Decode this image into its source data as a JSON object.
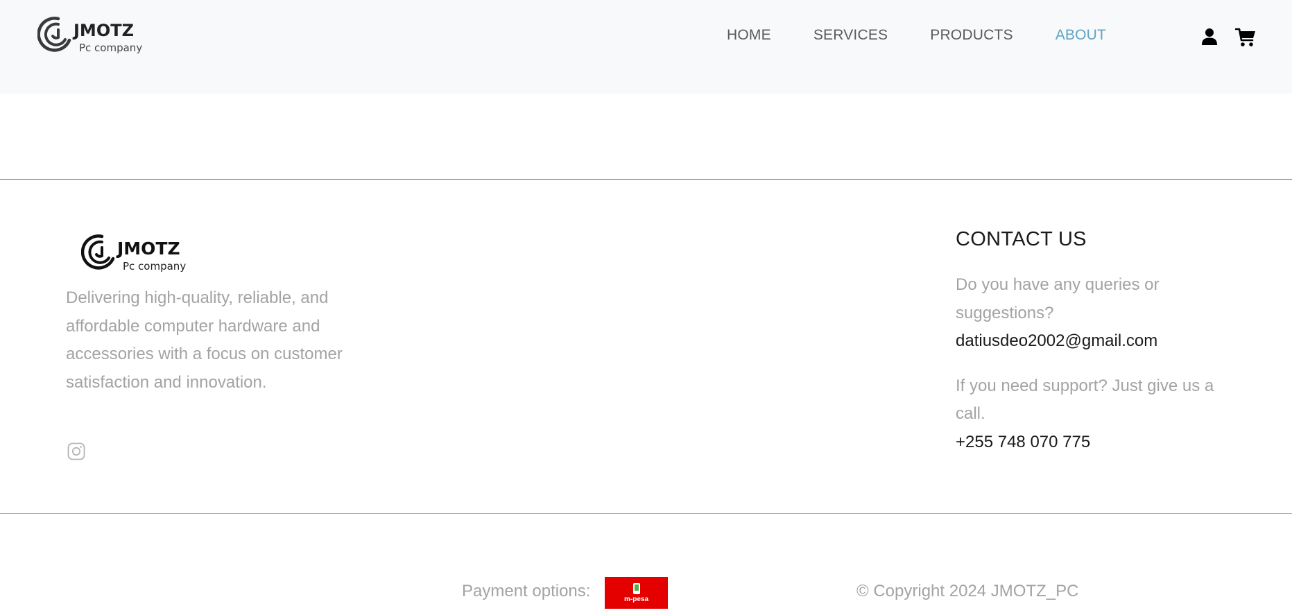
{
  "header": {
    "logo": {
      "brand": "JMOTZ",
      "tagline": "Pc company"
    },
    "nav": [
      {
        "label": "HOME",
        "active": false
      },
      {
        "label": "SERVICES",
        "active": false
      },
      {
        "label": "PRODUCTS",
        "active": false
      },
      {
        "label": "ABOUT",
        "active": true
      }
    ],
    "icons": {
      "user": "user-icon",
      "cart": "cart-icon"
    }
  },
  "footer": {
    "logo": {
      "brand": "JMOTZ",
      "tagline": "Pc company"
    },
    "about": "Delivering high-quality, reliable, and affordable computer hardware and accessories with a focus on customer satisfaction and innovation.",
    "social": [
      "instagram-icon"
    ],
    "contact": {
      "title": "CONTACT US",
      "queries_text": "Do you have any queries or suggestions?",
      "email": "datiusdeo2002@gmail.com",
      "support_text": "If you need support? Just give us a call.",
      "phone": "+255 748 070 775"
    },
    "payment": {
      "label": "Payment options:",
      "method": "m-pesa"
    },
    "copyright": "© Copyright 2024 JMOTZ_PC"
  },
  "colors": {
    "header_bg": "#f8f9fa",
    "nav_text": "#5a5a5a",
    "nav_active": "#5fa3c4",
    "muted_text": "#a3a3a3",
    "dark_text": "#1a1a1a",
    "mpesa_red": "#e50000"
  }
}
